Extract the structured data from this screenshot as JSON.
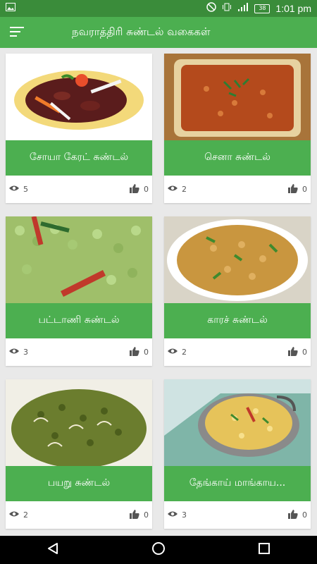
{
  "status_bar": {
    "time": "1:01 pm",
    "battery": "38",
    "icons": [
      "image-icon",
      "do-not-disturb-icon",
      "vibrate-icon",
      "signal-icon",
      "battery-icon"
    ]
  },
  "app_bar": {
    "title": "நவராத்திரி சுண்டல் வகைகள்",
    "menu_icon": "menu-icon"
  },
  "recipes": [
    {
      "title": "சோயா கேரட் சுண்டல்",
      "views": "5",
      "likes": "0"
    },
    {
      "title": "செனா சுண்டல்",
      "views": "2",
      "likes": "0"
    },
    {
      "title": "பட்டாணி சுண்டல்",
      "views": "3",
      "likes": "0"
    },
    {
      "title": "காரச் சுண்டல்",
      "views": "2",
      "likes": "0"
    },
    {
      "title": "பயறு சுண்டல்",
      "views": "2",
      "likes": "0"
    },
    {
      "title": "தேங்காய் மாங்காய...",
      "views": "3",
      "likes": "0"
    }
  ],
  "nav_bar": {
    "icons": [
      "back-icon",
      "home-icon",
      "recents-icon"
    ]
  },
  "colors": {
    "status": "#3a8c3a",
    "primary": "#4caf50",
    "background": "#e9e9e9"
  }
}
